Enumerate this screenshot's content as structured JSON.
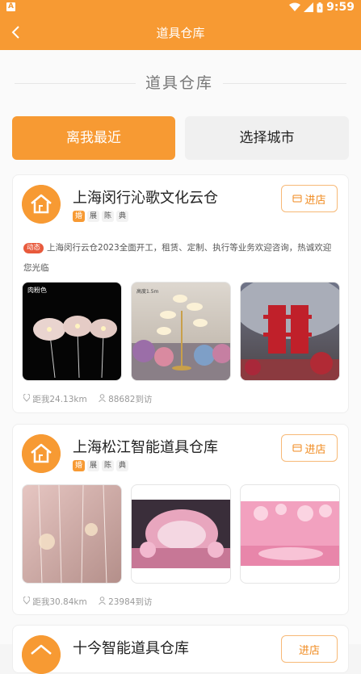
{
  "status_bar": {
    "time": "9:59",
    "app_icon": "A"
  },
  "app_bar": {
    "title": "道具仓库"
  },
  "section_title": "道具仓库",
  "tabs": [
    {
      "label": "离我最近",
      "active": true
    },
    {
      "label": "选择城市",
      "active": false
    }
  ],
  "cards": [
    {
      "name": "上海闵行沁歌文化云仓",
      "enter_label": "进店",
      "tags": [
        "婚",
        "展",
        "陈",
        "典"
      ],
      "dynamic_badge": "动态",
      "dynamic_text": "上海闵行云仓2023全面开工，租赁、定制、执行等业务欢迎咨询，热诚欢迎您光临",
      "images": [
        {
          "name": "pink-flower-props-photo",
          "caption": "肉粉色"
        },
        {
          "name": "golden-flower-stand-photo",
          "caption": "高度1.5m"
        },
        {
          "name": "double-happiness-decor-photo",
          "caption": ""
        }
      ],
      "distance": "距我24.13km",
      "visits": "88682到访"
    },
    {
      "name": "上海松江智能道具仓库",
      "enter_label": "进店",
      "tags": [
        "婚",
        "展",
        "陈",
        "典"
      ],
      "images": [
        {
          "name": "pink-crystal-decor-photo",
          "caption": ""
        },
        {
          "name": "wedding-stage-photo",
          "caption": ""
        },
        {
          "name": "pink-balloon-stage-photo",
          "caption": ""
        }
      ],
      "distance": "距我30.84km",
      "visits": "23984到访"
    },
    {
      "name": "十今智能道具仓库",
      "enter_label": "进店"
    }
  ],
  "colors": {
    "accent": "#f79a33",
    "badge": "#e85a3c"
  },
  "icons": [
    "back-arrow-icon",
    "wifi-icon",
    "signal-icon",
    "battery-icon",
    "house-logo-icon",
    "store-icon",
    "location-pin-icon",
    "person-icon"
  ]
}
